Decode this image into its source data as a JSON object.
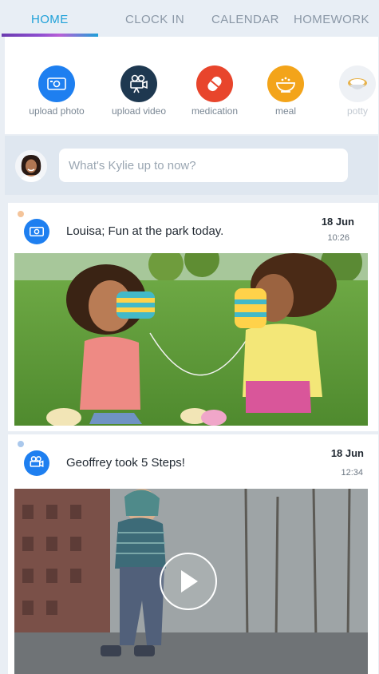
{
  "tabs": [
    {
      "label": "HOME",
      "active": true
    },
    {
      "label": "CLOCK IN",
      "active": false
    },
    {
      "label": "CALENDAR",
      "active": false
    },
    {
      "label": "HOMEWORK",
      "active": false
    }
  ],
  "actions": [
    {
      "label": "upload photo",
      "icon": "photo-icon",
      "color": "#1e7ff0"
    },
    {
      "label": "upload video",
      "icon": "video-camera-icon",
      "color": "#1e3850"
    },
    {
      "label": "medication",
      "icon": "pill-icon",
      "color": "#e8452c"
    },
    {
      "label": "meal",
      "icon": "meal-bowl-icon",
      "color": "#f3a41a"
    },
    {
      "label": "potty",
      "icon": "potty-icon",
      "color": "#eef1f5"
    }
  ],
  "composer": {
    "placeholder": "What's Kylie up to now?",
    "avatar_icon": "user-avatar-icon"
  },
  "posts": [
    {
      "title": "Louisa; Fun at the park today.",
      "date": "18 Jun",
      "time": "10:26",
      "type": "photo",
      "icon": "photo-icon",
      "dot_color": "#f4c49a"
    },
    {
      "title": "Geoffrey took 5 Steps!",
      "date": "18 Jun",
      "time": "12:34",
      "type": "video",
      "icon": "video-camera-icon",
      "dot_color": "#aac8ec"
    }
  ]
}
